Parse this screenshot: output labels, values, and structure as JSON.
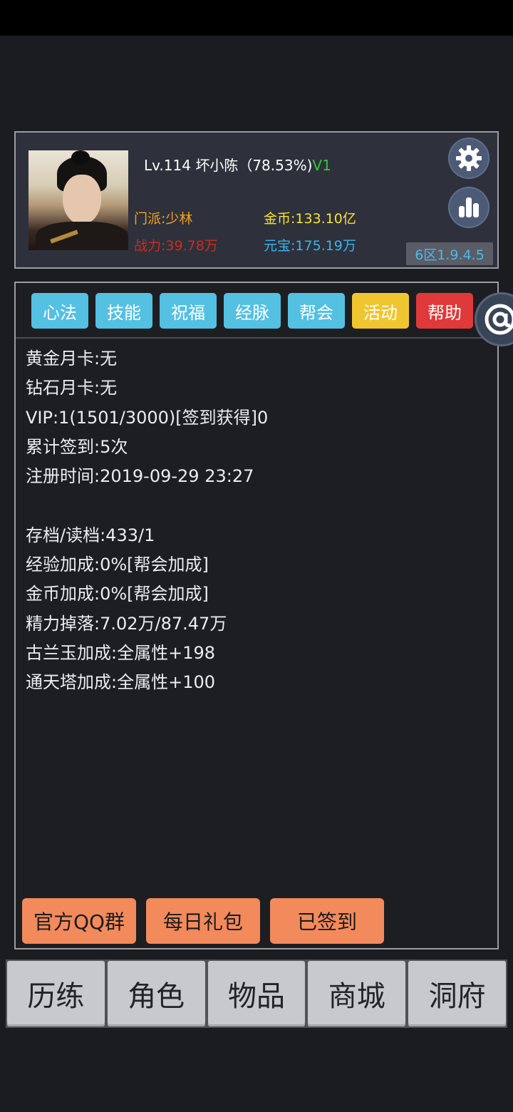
{
  "profile": {
    "title_main": "Lv.114 坏小陈（78.53%)",
    "vip_tag": "V1",
    "sect": "门派:少林",
    "power": "战力:39.78万",
    "gold": "金币:133.10亿",
    "ingot": "元宝:175.19万",
    "server": "6区1.9.4.5"
  },
  "tabs": [
    "心法",
    "技能",
    "祝福",
    "经脉",
    "帮会",
    "活动",
    "帮助"
  ],
  "info_lines": [
    "黄金月卡:无",
    "钻石月卡:无",
    "VIP:1(1501/3000)[签到获得]0",
    "累计签到:5次",
    "注册时间:2019-09-29 23:27",
    "",
    "存档/读档:433/1",
    "经验加成:0%[帮会加成]",
    "金币加成:0%[帮会加成]",
    "精力掉落:7.02万/87.47万",
    "古兰玉加成:全属性+198",
    "通天塔加成:全属性+100"
  ],
  "actions": [
    "官方QQ群",
    "每日礼包",
    "已签到"
  ],
  "nav": [
    "历练",
    "角色",
    "物品",
    "商城",
    "洞府"
  ],
  "colors": {
    "tab": "#54c0e2",
    "tab_activity": "#f0c630",
    "tab_help": "#e0393a",
    "action_button": "#f28a5c",
    "sect_text": "#f5a11c",
    "power_text": "#cc2a1f",
    "gold_text": "#f4e23a",
    "ingot_text": "#35b6f0",
    "vip_text": "#34c640"
  },
  "icons": {
    "settings": "gear-icon",
    "ranking": "bar-chart-icon",
    "float": "at-sign-icon"
  }
}
